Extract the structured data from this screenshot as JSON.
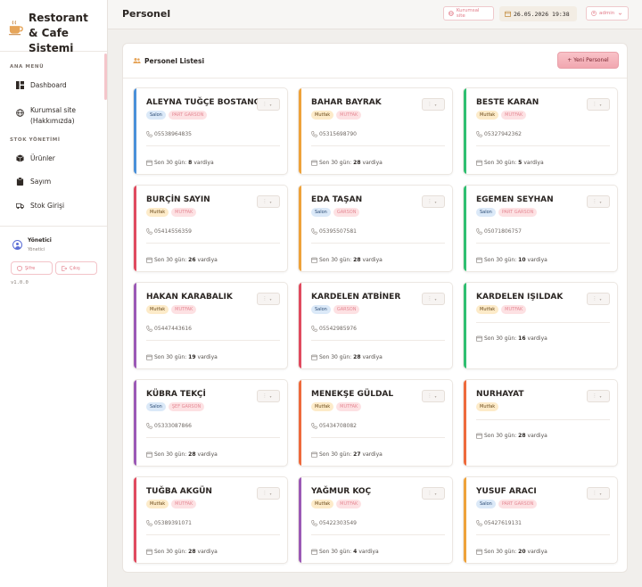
{
  "app": {
    "brand_title": "Restorant & Cafe Sistemi",
    "version": "v1.0.0"
  },
  "sidebar": {
    "sections": [
      {
        "label": "ANA MENÜ"
      },
      {
        "label": "STOK YÖNETİMİ"
      }
    ],
    "items": [
      {
        "label": "Dashboard",
        "icon": "dashboard-icon"
      },
      {
        "label": "Kurumsal site (Hakkımızda)",
        "icon": "globe-icon"
      },
      {
        "label": "Ürünler",
        "icon": "box-icon"
      },
      {
        "label": "Sayım",
        "icon": "clipboard-icon"
      },
      {
        "label": "Stok Girişi",
        "icon": "truck-icon"
      }
    ],
    "user": {
      "name": "Yönetici",
      "role": "Yönetici"
    },
    "buttons": {
      "password": "Şifre",
      "logout": "Çıkış"
    }
  },
  "header": {
    "title": "Personel",
    "site_link": "Kurumsal site",
    "datetime": "26.05.2026 19:38",
    "user_menu": "admin"
  },
  "panel": {
    "title": "Personel Listesi",
    "new_button": "+ Yeni Personel",
    "shift_prefix": "Son 30 gün:",
    "shift_suffix": "vardiya"
  },
  "colors": {
    "accent": "#f1a7b0",
    "blue": "#4a90d9",
    "orange": "#eea23a",
    "green": "#2fbf71",
    "purple": "#9b59b6",
    "red": "#e04a5f",
    "coral": "#ee6a3c"
  },
  "staff": [
    {
      "name": "ALEYNA TUĞÇE BOSTANCI",
      "dept": "Salon",
      "role": "PART GARSON",
      "phone": "05538964835",
      "shifts": "8",
      "color": "#4a90d9"
    },
    {
      "name": "BAHAR BAYRAK",
      "dept": "Mutfak",
      "role": "MUTFAK",
      "phone": "05315698790",
      "shifts": "28",
      "color": "#eea23a"
    },
    {
      "name": "BESTE KARAN",
      "dept": "Mutfak",
      "role": "MUTFAK",
      "phone": "05327942362",
      "shifts": "5",
      "color": "#2fbf71"
    },
    {
      "name": "BURÇİN SAYIN",
      "dept": "Mutfak",
      "role": "MUTFAK",
      "phone": "05414556359",
      "shifts": "26",
      "color": "#e04a5f"
    },
    {
      "name": "EDA TAŞAN",
      "dept": "Salon",
      "role": "GARSON",
      "phone": "05395507581",
      "shifts": "28",
      "color": "#eea23a"
    },
    {
      "name": "EGEMEN SEYHAN",
      "dept": "Salon",
      "role": "PART GARSON",
      "phone": "05071806757",
      "shifts": "10",
      "color": "#2fbf71"
    },
    {
      "name": "HAKAN KARABALIK",
      "dept": "Mutfak",
      "role": "MUTFAK",
      "phone": "05447443616",
      "shifts": "19",
      "color": "#9b59b6"
    },
    {
      "name": "KARDELEN ATBİNER",
      "dept": "Salon",
      "role": "GARSON",
      "phone": "05542985976",
      "shifts": "28",
      "color": "#e04a5f"
    },
    {
      "name": "KARDELEN IŞILDAK",
      "dept": "Mutfak",
      "role": "MUTFAK",
      "phone": "",
      "shifts": "16",
      "color": "#2fbf71"
    },
    {
      "name": "KÜBRA TEKÇİ",
      "dept": "Salon",
      "role": "ŞEF GARSON",
      "phone": "05333087866",
      "shifts": "28",
      "color": "#9b59b6"
    },
    {
      "name": "MENEKŞE GÜLDAL",
      "dept": "Mutfak",
      "role": "MUTFAK",
      "phone": "05434708082",
      "shifts": "27",
      "color": "#ee6a3c"
    },
    {
      "name": "NURHAYAT",
      "dept": "Mutfak",
      "role": "",
      "phone": "",
      "shifts": "28",
      "color": "#ee6a3c"
    },
    {
      "name": "TUĞBA AKGÜN",
      "dept": "Mutfak",
      "role": "MUTFAK",
      "phone": "05389391071",
      "shifts": "28",
      "color": "#e04a5f"
    },
    {
      "name": "YAĞMUR KOÇ",
      "dept": "Mutfak",
      "role": "MUTFAK",
      "phone": "05422303549",
      "shifts": "4",
      "color": "#9b59b6"
    },
    {
      "name": "YUSUF ARACI",
      "dept": "Salon",
      "role": "PART GARSON",
      "phone": "05427619131",
      "shifts": "20",
      "color": "#eea23a"
    }
  ]
}
